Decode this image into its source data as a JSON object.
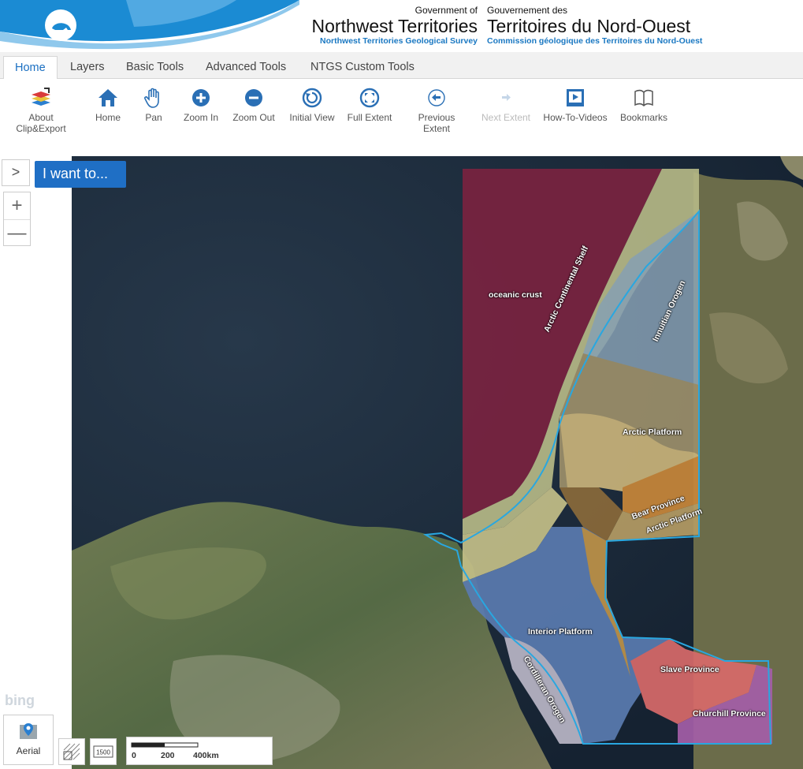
{
  "header": {
    "en_small": "Government of",
    "en_big": "Northwest Territories",
    "en_sub": "Northwest Territories Geological Survey",
    "fr_small": "Gouvernement des",
    "fr_big": "Territoires du Nord-Ouest",
    "fr_sub": "Commission géologique des Territoires du Nord-Ouest"
  },
  "tabs": [
    {
      "label": "Home",
      "active": true
    },
    {
      "label": "Layers"
    },
    {
      "label": "Basic Tools"
    },
    {
      "label": "Advanced Tools"
    },
    {
      "label": "NTGS Custom Tools"
    }
  ],
  "toolbar": {
    "about": {
      "line1": "About",
      "line2": "Clip&Export"
    },
    "home": "Home",
    "pan": "Pan",
    "zoom_in": "Zoom In",
    "zoom_out": "Zoom Out",
    "initial_view": "Initial View",
    "full_extent": "Full Extent",
    "previous_extent": "Previous Extent",
    "next_extent": "Next Extent",
    "how_to_videos": "How-To-Videos",
    "bookmarks": "Bookmarks"
  },
  "map": {
    "expand_glyph": ">",
    "i_want_to": "I want to...",
    "zoom_in_glyph": "+",
    "zoom_out_glyph": "—",
    "bing": "bing",
    "aerial": "Aerial",
    "scale_1500": "1500",
    "scale_ticks": [
      "0",
      "200",
      "400km"
    ],
    "labels": {
      "oceanic_crust": "oceanic crust",
      "arctic_shelf": "Arctic Continental Shelf",
      "innuitian": "Innuitian Orogen",
      "arctic_platform": "Arctic Platform",
      "bear_province": "Bear Province",
      "arctic_platform_2": "Arctic Platform",
      "interior_platform": "Interior Platform",
      "cordilleran": "Cordilleran Orogen",
      "slave_province": "Slave Province",
      "churchill_province": "Churchill Province"
    }
  },
  "colors": {
    "accent": "#1f6fc5",
    "oceanic_crust": "#7a2340",
    "shelf": "#b5b886",
    "interior": "#5a7bb0",
    "slave": "#d86a6a",
    "churchill": "#a45ea8",
    "bear": "#c8873a",
    "boundary": "#29a7e0"
  }
}
